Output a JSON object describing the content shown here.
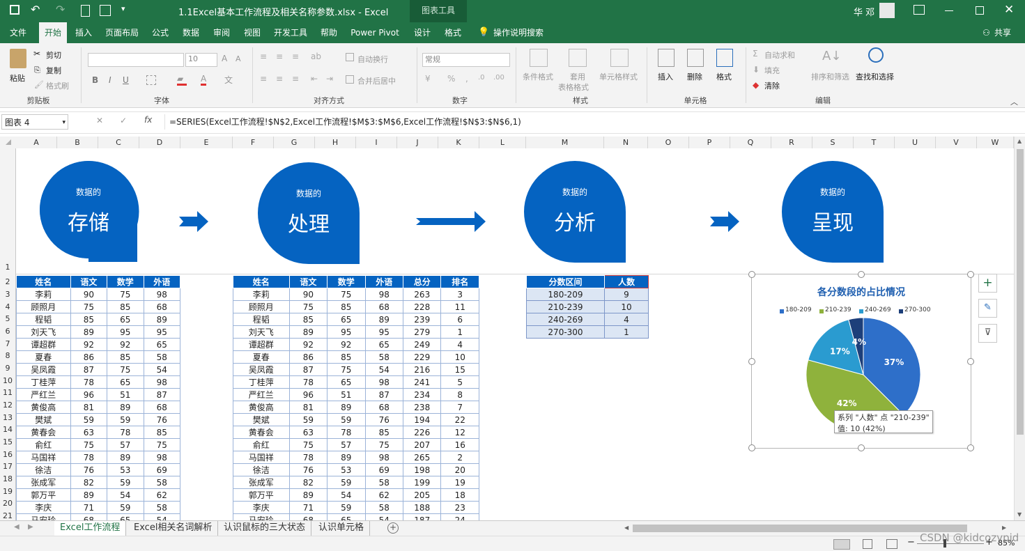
{
  "window": {
    "title": "1.1Excel基本工作流程及相关名称参数.xlsx  -  Excel",
    "context_title": "图表工具",
    "user": "华 邓"
  },
  "tabs": [
    "文件",
    "开始",
    "插入",
    "页面布局",
    "公式",
    "数据",
    "审阅",
    "视图",
    "开发工具",
    "帮助",
    "Power Pivot",
    "设计",
    "格式"
  ],
  "tell_me": "操作说明搜索",
  "share": "共享",
  "ribbon": {
    "clipboard": {
      "paste": "粘贴",
      "cut": "剪切",
      "copy": "复制",
      "format_painter": "格式刷",
      "group": "剪贴板"
    },
    "font": {
      "size": "10",
      "bold": "B",
      "italic": "I",
      "underline": "U",
      "group": "字体"
    },
    "alignment": {
      "wrap": "自动换行",
      "merge": "合并后居中",
      "group": "对齐方式"
    },
    "number": {
      "format": "常规",
      "group": "数字"
    },
    "styles": {
      "conditional": "条件格式",
      "table_1": "套用",
      "table_2": "表格格式",
      "cell_styles": "单元格样式",
      "group": "样式"
    },
    "cells": {
      "insert": "插入",
      "delete": "删除",
      "format": "格式",
      "group": "单元格"
    },
    "editing": {
      "autosum": "自动求和",
      "fill": "填充",
      "clear": "清除",
      "sort": "排序和筛选",
      "find": "查找和选择",
      "group": "编辑"
    }
  },
  "formula_bar": {
    "name_box": "图表 4",
    "formula": "=SERIES(Excel工作流程!$N$2,Excel工作流程!$M$3:$M$6,Excel工作流程!$N$3:$N$6,1)"
  },
  "columns": [
    "A",
    "B",
    "C",
    "D",
    "E",
    "F",
    "G",
    "H",
    "I",
    "J",
    "K",
    "L",
    "M",
    "N",
    "O",
    "P",
    "Q",
    "R",
    "S",
    "T",
    "U",
    "V",
    "W"
  ],
  "rows": [
    "1",
    "2",
    "3",
    "4",
    "5",
    "6",
    "7",
    "8",
    "9",
    "10",
    "11",
    "12",
    "13",
    "14",
    "15",
    "16",
    "17",
    "18",
    "19",
    "20",
    "21"
  ],
  "banner": {
    "prefix": "数据的",
    "steps": [
      "存储",
      "处理",
      "分析",
      "呈现"
    ]
  },
  "table1": {
    "headers": [
      "姓名",
      "语文",
      "数学",
      "外语"
    ],
    "rows": [
      [
        "李莉",
        "90",
        "75",
        "98"
      ],
      [
        "顾照月",
        "75",
        "85",
        "68"
      ],
      [
        "程韬",
        "85",
        "65",
        "89"
      ],
      [
        "刘天飞",
        "89",
        "95",
        "95"
      ],
      [
        "谭超群",
        "92",
        "92",
        "65"
      ],
      [
        "夏春",
        "86",
        "85",
        "58"
      ],
      [
        "吴凤霞",
        "87",
        "75",
        "54"
      ],
      [
        "丁桂萍",
        "78",
        "65",
        "98"
      ],
      [
        "严红兰",
        "96",
        "51",
        "87"
      ],
      [
        "黄俊高",
        "81",
        "89",
        "68"
      ],
      [
        "樊斌",
        "59",
        "59",
        "76"
      ],
      [
        "黄春会",
        "63",
        "78",
        "85"
      ],
      [
        "俞红",
        "75",
        "57",
        "75"
      ],
      [
        "马国祥",
        "78",
        "89",
        "98"
      ],
      [
        "徐洁",
        "76",
        "53",
        "69"
      ],
      [
        "张成军",
        "82",
        "59",
        "58"
      ],
      [
        "郭万平",
        "89",
        "54",
        "62"
      ],
      [
        "李庆",
        "71",
        "59",
        "58"
      ],
      [
        "马安玲",
        "68",
        "65",
        "54"
      ]
    ]
  },
  "table2": {
    "headers": [
      "姓名",
      "语文",
      "数学",
      "外语",
      "总分",
      "排名"
    ],
    "rows": [
      [
        "李莉",
        "90",
        "75",
        "98",
        "263",
        "3"
      ],
      [
        "顾照月",
        "75",
        "85",
        "68",
        "228",
        "11"
      ],
      [
        "程韬",
        "85",
        "65",
        "89",
        "239",
        "6"
      ],
      [
        "刘天飞",
        "89",
        "95",
        "95",
        "279",
        "1"
      ],
      [
        "谭超群",
        "92",
        "92",
        "65",
        "249",
        "4"
      ],
      [
        "夏春",
        "86",
        "85",
        "58",
        "229",
        "10"
      ],
      [
        "吴凤霞",
        "87",
        "75",
        "54",
        "216",
        "15"
      ],
      [
        "丁桂萍",
        "78",
        "65",
        "98",
        "241",
        "5"
      ],
      [
        "严红兰",
        "96",
        "51",
        "87",
        "234",
        "8"
      ],
      [
        "黄俊高",
        "81",
        "89",
        "68",
        "238",
        "7"
      ],
      [
        "樊斌",
        "59",
        "59",
        "76",
        "194",
        "22"
      ],
      [
        "黄春会",
        "63",
        "78",
        "85",
        "226",
        "12"
      ],
      [
        "俞红",
        "75",
        "57",
        "75",
        "207",
        "16"
      ],
      [
        "马国祥",
        "78",
        "89",
        "98",
        "265",
        "2"
      ],
      [
        "徐洁",
        "76",
        "53",
        "69",
        "198",
        "20"
      ],
      [
        "张成军",
        "82",
        "59",
        "58",
        "199",
        "19"
      ],
      [
        "郭万平",
        "89",
        "54",
        "62",
        "205",
        "18"
      ],
      [
        "李庆",
        "71",
        "59",
        "58",
        "188",
        "23"
      ],
      [
        "马安玲",
        "68",
        "65",
        "54",
        "187",
        "24"
      ]
    ]
  },
  "table3": {
    "headers": [
      "分数区间",
      "人数"
    ],
    "rows": [
      [
        "180-209",
        "9"
      ],
      [
        "210-239",
        "10"
      ],
      [
        "240-269",
        "4"
      ],
      [
        "270-300",
        "1"
      ]
    ]
  },
  "chart_data": {
    "type": "pie",
    "title": "各分数段的占比情况",
    "categories": [
      "180-209",
      "210-239",
      "240-269",
      "270-300"
    ],
    "values": [
      9,
      10,
      4,
      1
    ],
    "labels": [
      "37%",
      "42%",
      "17%",
      "4%"
    ],
    "colors": [
      "#2e6fc9",
      "#8fb23c",
      "#2a9bd0",
      "#1d3f7a"
    ],
    "legend": "top"
  },
  "tooltip": {
    "line1": "系列 \"人数\" 点 \"210-239\"",
    "line2": "值: 10 (42%)"
  },
  "sheet_tabs": [
    "Excel工作流程",
    "Excel相关名词解析",
    "认识鼠标的三大状态",
    "认识单元格"
  ],
  "status": {
    "zoom": "85%",
    "watermark": "CSDN @kidcozypid"
  }
}
